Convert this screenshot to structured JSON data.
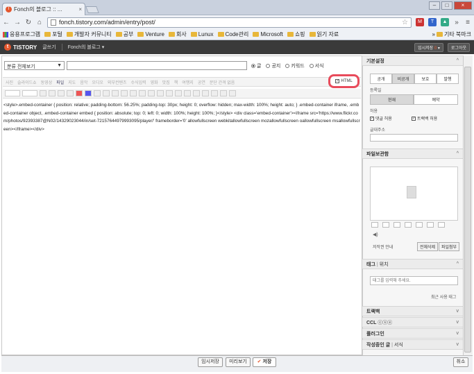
{
  "browser": {
    "tab_title": "Fonch의 블로그 :: ...",
    "url": "fonch.tistory.com/admin/entry/post/",
    "bookmarks": [
      "응용프로그램",
      "포털",
      "개발자 커뮤니티",
      "공부",
      "Venture",
      "회사",
      "Lunux",
      "Code관리",
      "Microsoft",
      "쇼핑",
      "읽기 자료"
    ],
    "other_bookmarks": "기타 북마크"
  },
  "tistory": {
    "logo": "TISTORY",
    "write": "글쓰기",
    "blog_name": "Fonch의 블로그",
    "temp_save_pill": "임시저장",
    "temp_count": "0",
    "logout": "로그아웃"
  },
  "editor": {
    "category": "분류 전체보기",
    "radios": [
      {
        "label": "글",
        "on": true
      },
      {
        "label": "공지",
        "on": false
      },
      {
        "label": "키워드",
        "on": false
      },
      {
        "label": "서식",
        "on": false
      }
    ],
    "toolbar_items": [
      "사진",
      "슬라이드쇼",
      "동영상",
      "파일",
      "지도",
      "음악",
      "오디오",
      "외부컨텐츠",
      "수식입력",
      "영화",
      "맛집",
      "책",
      "여행지",
      "공연",
      "문단 간격 없음"
    ],
    "html_label": "HTML",
    "code_lines": [
      "<style>.embed-container { position: relative; padding-bottom: 56.25%; padding-top: 30px; height: 0; overflow: hidden; max-width: 100%; height: auto; } .embed-container iframe, .embed-container object, .embed-container embed { position: absolute; top: 0; left: 0; width: 100%; height: 100%; }</style> <div class='embed-container'><iframe src='https://www.flickr.com/photos/92393387@N02/14329023044/in/set-72157644979993095/player/' frameborder='0' allowfullscreen webkitallowfullscreen mozallowfullscreen oallowfullscreen msallowfullscreen></iframe></div>"
    ]
  },
  "side": {
    "basic_settings": "기본설정",
    "visibility": [
      "공개",
      "비공개",
      "보호",
      "발행"
    ],
    "registered": "등록일",
    "reg_options": [
      "현재",
      "예약"
    ],
    "allow": "허용",
    "comment_allow": "댓글 허용",
    "trackback_allow": "트랙백 허용",
    "perm_address": "글대주소",
    "attachments": "파일보관함",
    "copyright": "저작권 안내",
    "delete_all": "전체삭제",
    "attach_file": "파일첨부",
    "tags": "태그",
    "location": "위치",
    "tag_placeholder": "태그를 입력해 주세요.",
    "recent_tags": "최근 사용 태그",
    "trackback": "트랙백",
    "ccl": "CCL",
    "plugin": "플러그인",
    "writing_post": "작성중인 글",
    "templates": "서식"
  },
  "bottom": {
    "temp_save": "임시저장",
    "preview": "미리보기",
    "save": "저장",
    "cancel": "취소"
  },
  "colors": {
    "accent": "#e4572e",
    "highlight": "#e84b5b",
    "topbar": "#3a3a3a"
  }
}
